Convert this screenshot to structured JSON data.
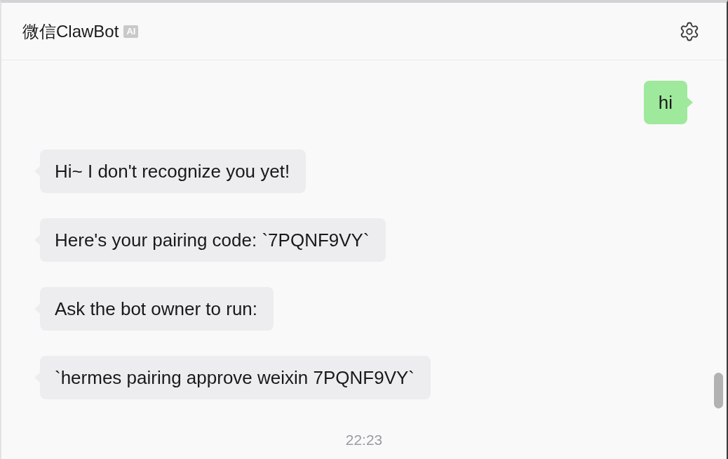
{
  "header": {
    "title": "微信ClawBot",
    "badge": "AI"
  },
  "messages": [
    {
      "kind": "sent",
      "text": "hi"
    },
    {
      "kind": "received",
      "text": "Hi~ I don't recognize you yet!"
    },
    {
      "kind": "received",
      "text": "Here's your pairing code: `7PQNF9VY`"
    },
    {
      "kind": "received",
      "text": "Ask the bot owner to run:"
    },
    {
      "kind": "received",
      "text": "`hermes pairing approve weixin 7PQNF9VY`"
    }
  ],
  "timestamp": "22:23"
}
